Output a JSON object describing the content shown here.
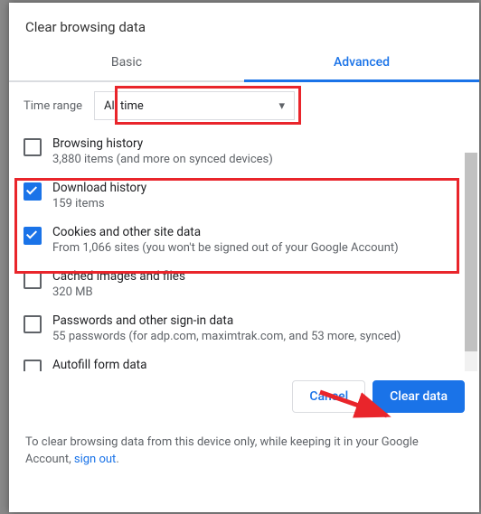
{
  "dialog": {
    "title": "Clear browsing data",
    "tabs": {
      "basic": "Basic",
      "advanced": "Advanced"
    },
    "time_range_label": "Time range",
    "time_range_value": "All time",
    "items": [
      {
        "title": "Browsing history",
        "sub": "3,880 items (and more on synced devices)",
        "checked": false
      },
      {
        "title": "Download history",
        "sub": "159 items",
        "checked": true
      },
      {
        "title": "Cookies and other site data",
        "sub": "From 1,066 sites (you won't be signed out of your Google Account)",
        "checked": true
      },
      {
        "title": "Cached images and files",
        "sub": "320 MB",
        "checked": false
      },
      {
        "title": "Passwords and other sign-in data",
        "sub": "55 passwords (for adp.com, maximtrak.com, and 53 more, synced)",
        "checked": false
      },
      {
        "title": "Autofill form data",
        "sub": "",
        "checked": false
      }
    ],
    "cancel": "Cancel",
    "clear": "Clear data",
    "note_prefix": "To clear browsing data from this device only, while keeping it in your Google Account, ",
    "note_link": "sign out",
    "note_suffix": "."
  }
}
